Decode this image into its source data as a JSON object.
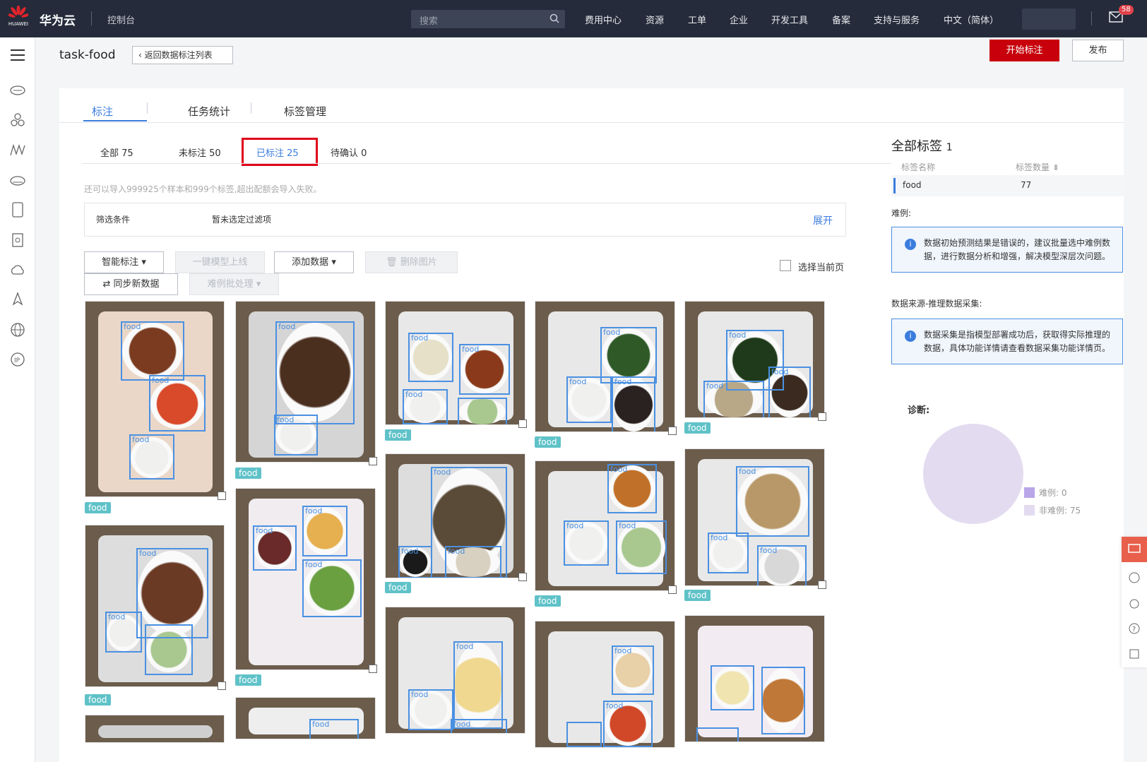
{
  "topbar": {
    "brand": "华为云",
    "logo_text": "HUAWEI",
    "console": "控制台",
    "search_placeholder": "搜索",
    "nav": [
      "费用中心",
      "资源",
      "工单",
      "企业",
      "开发工具",
      "备案",
      "支持与服务",
      "中文（简体）"
    ],
    "mail_count": "58"
  },
  "page": {
    "title": "task-food",
    "back_label": "返回数据标注列表",
    "start_label": "开始标注",
    "publish_label": "发布"
  },
  "tabs": [
    "标注",
    "任务统计",
    "标签管理"
  ],
  "subtabs": [
    {
      "label": "全部",
      "count": "75"
    },
    {
      "label": "未标注",
      "count": "50"
    },
    {
      "label": "已标注",
      "count": "25"
    },
    {
      "label": "待确认",
      "count": "0"
    }
  ],
  "hint": "还可以导入999925个样本和999个标签,超出配额会导入失败。",
  "filter": {
    "label": "筛选条件",
    "value": "暂未选定过滤项",
    "expand": "展开"
  },
  "toolbar": {
    "smart": "智能标注",
    "deploy": "一键模型上线",
    "add": "添加数据",
    "delete": "删除图片",
    "sync": "同步新数据",
    "hard": "难例批处理",
    "select_page": "选择当前页"
  },
  "images": [
    {
      "tag": "food",
      "boxes": [
        "food",
        "food",
        "food"
      ]
    },
    {
      "tag": "food",
      "boxes": [
        "food",
        "food"
      ]
    },
    {
      "tag": "food",
      "boxes": [
        "food",
        "food",
        "food",
        "food"
      ]
    },
    {
      "tag": "food",
      "boxes": [
        "food",
        "food",
        "food"
      ]
    },
    {
      "tag": "food",
      "boxes": [
        "food",
        "food",
        "food"
      ]
    },
    {
      "tag": "food",
      "boxes": [
        "food",
        "food",
        "food"
      ]
    },
    {
      "tag": "food",
      "boxes": [
        "food",
        "food",
        "food"
      ]
    },
    {
      "tag": "food",
      "boxes": [
        "food",
        "food",
        "food"
      ]
    },
    {
      "tag": "food",
      "boxes": [
        "food",
        "food",
        "food"
      ]
    },
    {
      "tag": "food",
      "boxes": [
        "food",
        "food",
        "food"
      ]
    },
    {
      "tag": "food",
      "boxes": [
        "food",
        "food"
      ]
    },
    {
      "tag": "food",
      "boxes": [
        "food",
        "food",
        "food"
      ]
    },
    {
      "tag": "food",
      "boxes": [
        "food",
        "food",
        "food",
        "food"
      ]
    }
  ],
  "right": {
    "title": "全部标签",
    "count": "1",
    "col_name": "标签名称",
    "col_count": "标签数量",
    "label_name": "food",
    "label_count": "77",
    "hard_title": "难例:",
    "hard_note": "数据初始预测结果是错误的，建议批量选中难例数据，进行数据分析和增强，解决模型深层次问题。",
    "source_title": "数据来源-推理数据采集:",
    "source_note": "数据采集是指模型部署成功后，获取得实际推理的数据，具体功能详情请查看数据采集功能详情页。",
    "diag_title": "诊断:",
    "legend": [
      {
        "label": "难例: 0",
        "value": 0,
        "color": "#b9a6e8"
      },
      {
        "label": "非难例: 75",
        "value": 75,
        "color": "#e3dcf0"
      }
    ]
  }
}
